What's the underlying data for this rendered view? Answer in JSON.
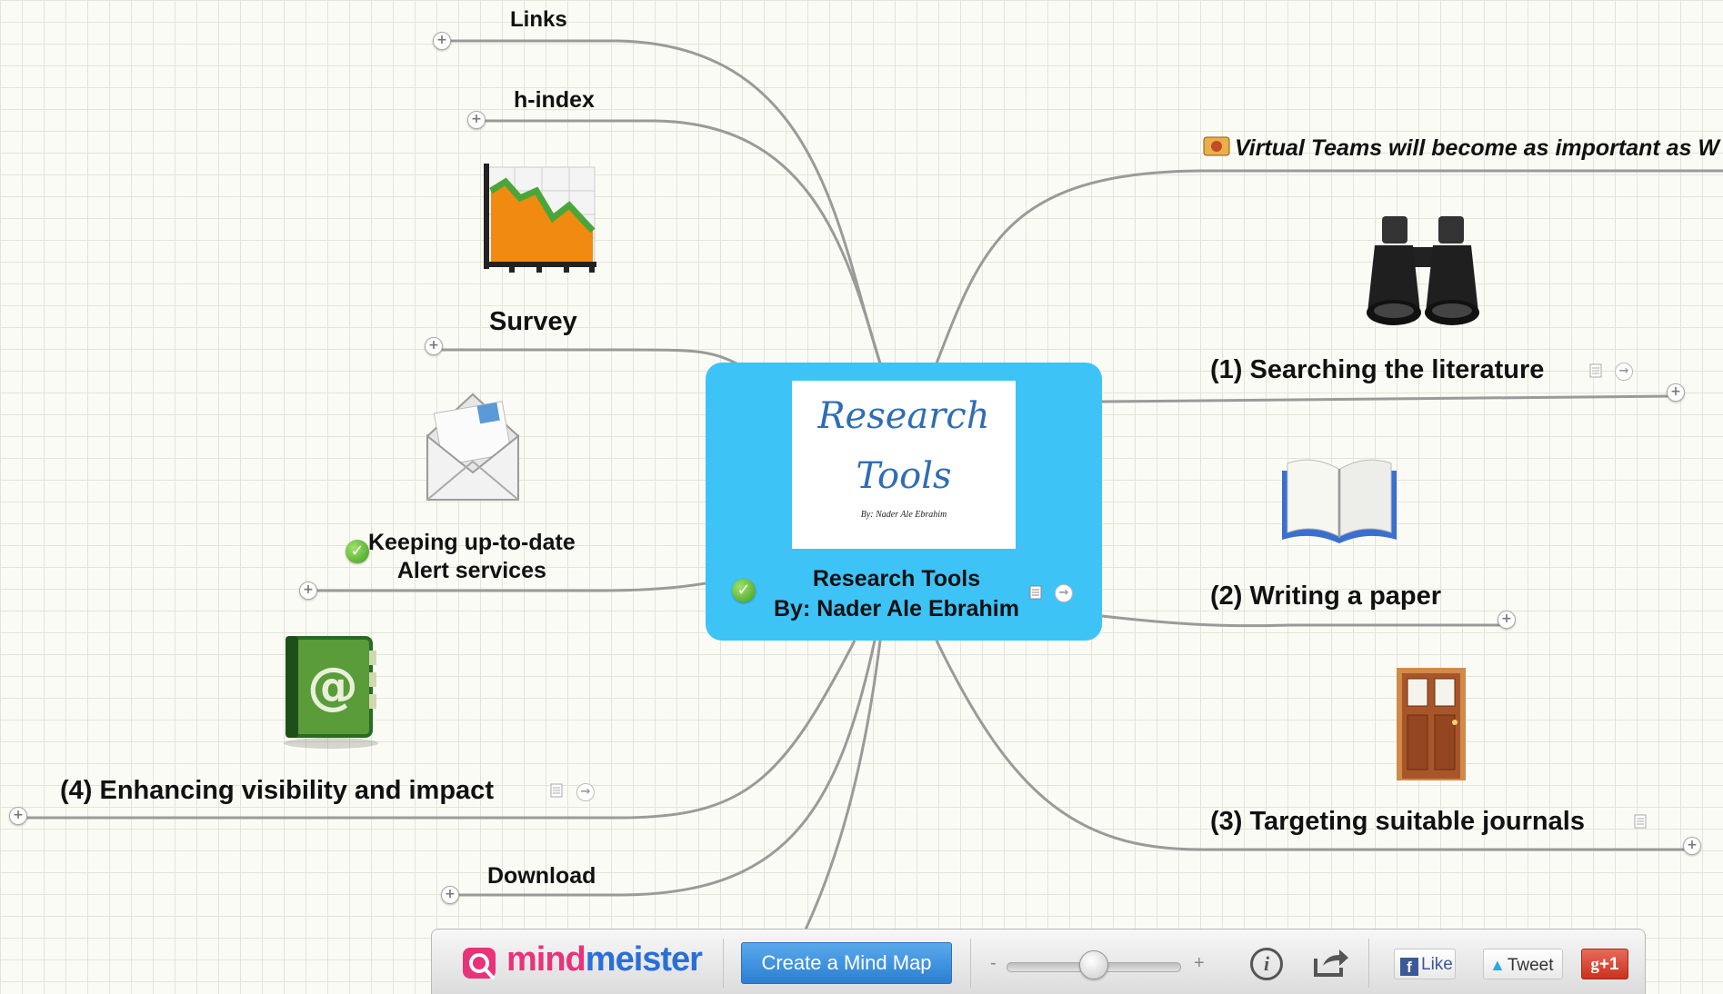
{
  "map": {
    "central": {
      "image_title_line1": "Research",
      "image_title_line2": "Tools",
      "image_byline": "By: Nader Ale Ebrahim",
      "title_line1": "Research Tools",
      "title_line2": "By: Nader Ale Ebrahim"
    },
    "nodes": {
      "links": "Links",
      "hindex": "h-index",
      "survey": "Survey",
      "keeping_line1": "Keeping up-to-date",
      "keeping_line2": "Alert services",
      "enhancing": "(4) Enhancing visibility and impact",
      "download": "Download",
      "virtual_teams": "Virtual Teams will become as important as W",
      "searching": "(1) Searching the literature",
      "writing": "(2) Writing a paper",
      "targeting": "(3) Targeting suitable journals"
    },
    "expander_symbol": "+",
    "check_symbol": "✓",
    "link_symbol": "→"
  },
  "toolbar": {
    "logo_part1": "mind",
    "logo_part2": "meister",
    "create_button": "Create a Mind Map",
    "zoom_minus": "-",
    "zoom_plus": "+",
    "zoom_level": 0.5,
    "info_label": "i",
    "share_icon": "share-icon",
    "like_label": "Like",
    "tweet_label": "Tweet",
    "gplus_label": "+1"
  },
  "colors": {
    "central_bg": "#3ec3f7",
    "branch": "#9a9a9a",
    "logo_pink": "#e8327a",
    "logo_blue": "#2b6fd6",
    "create_button": "#3a8fe0"
  }
}
